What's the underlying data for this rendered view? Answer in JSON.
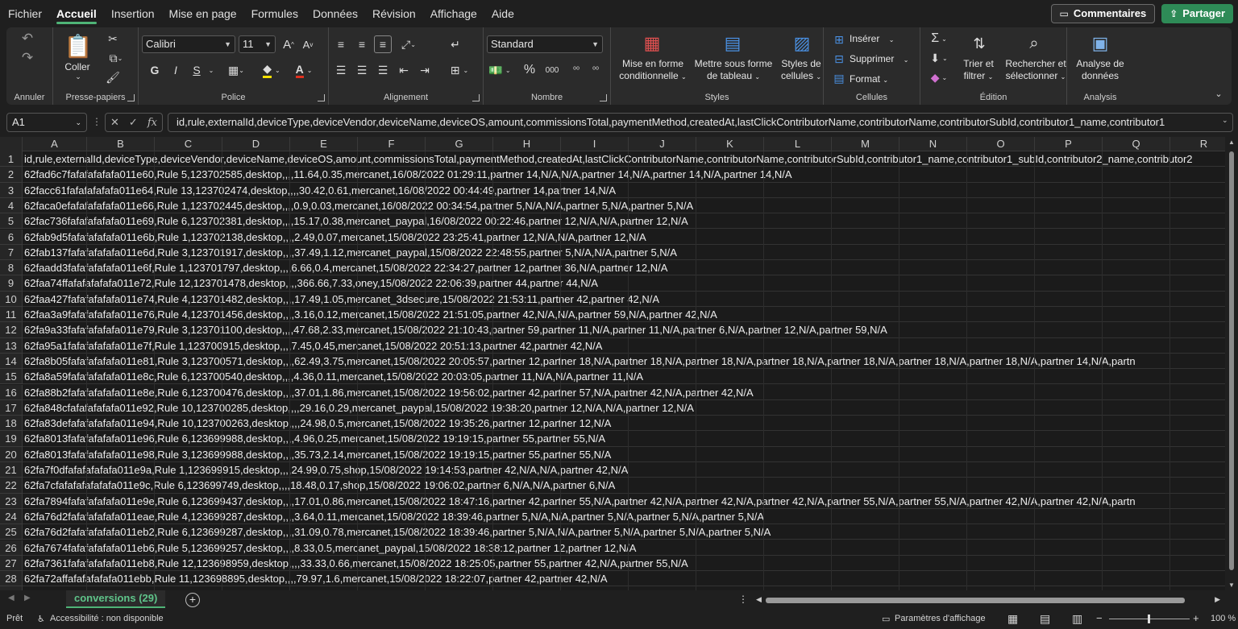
{
  "menu": {
    "items": [
      "Fichier",
      "Accueil",
      "Insertion",
      "Mise en page",
      "Formules",
      "Données",
      "Révision",
      "Affichage",
      "Aide"
    ],
    "active_index": 1,
    "comments_label": "Commentaires",
    "share_label": "Partager"
  },
  "ribbon": {
    "undo_label": "Annuler",
    "clipboard": {
      "paste_label": "Coller",
      "group_label": "Presse-papiers"
    },
    "font": {
      "name": "Calibri",
      "size": "11",
      "group_label": "Police",
      "bold": "G",
      "italic": "I",
      "underline": "S",
      "grow": "A",
      "shrink": "A"
    },
    "alignment": {
      "group_label": "Alignement"
    },
    "number": {
      "format": "Standard",
      "group_label": "Nombre",
      "percent": "%",
      "thousands": "000"
    },
    "styles": {
      "conditional": [
        "Mise en forme",
        "conditionnelle"
      ],
      "table": [
        "Mettre sous forme",
        "de tableau"
      ],
      "cell_styles": [
        "Styles de",
        "cellules"
      ],
      "group_label": "Styles"
    },
    "cells": {
      "insert": "Insérer",
      "delete": "Supprimer",
      "format": "Format",
      "group_label": "Cellules"
    },
    "editing": {
      "sort": [
        "Trier et",
        "filtrer"
      ],
      "find": [
        "Rechercher et",
        "sélectionner"
      ],
      "group_label": "Édition"
    },
    "analysis": {
      "analyze": [
        "Analyse de",
        "données"
      ],
      "group_label": "Analysis"
    }
  },
  "formula_bar": {
    "cell_ref": "A1",
    "content": "id,rule,externalId,deviceType,deviceVendor,deviceName,deviceOS,amount,commissionsTotal,paymentMethod,createdAt,lastClickContributorName,contributorName,contributorSubId,contributor1_name,contributor1"
  },
  "grid": {
    "columns": [
      "A",
      "B",
      "C",
      "D",
      "E",
      "F",
      "G",
      "H",
      "I",
      "J",
      "K",
      "L",
      "M",
      "N",
      "O",
      "P",
      "Q",
      "R"
    ],
    "rows": [
      "id,rule,externalId,deviceType,deviceVendor,deviceName,deviceOS,amount,commissionsTotal,paymentMethod,createdAt,lastClickContributorName,contributorName,contributorSubId,contributor1_name,contributor1_subId,contributor2_name,contributor2",
      "62fad6c7fafafafafafa011e60,Rule 5,123702585,desktop,,,,11.64,0.35,mercanet,16/08/2022 01:29:11,partner 14,N/A,N/A,partner 14,N/A,partner 14,N/A,partner 14,N/A",
      "62facc61fafafafafafa011e64,Rule 13,123702474,desktop,,,,30.42,0.61,mercanet,16/08/2022 00:44:49,partner 14,partner 14,N/A",
      "62faca0efafafafafafa011e66,Rule 1,123702445,desktop,,,,0.9,0.03,mercanet,16/08/2022 00:34:54,partner 5,N/A,N/A,partner 5,N/A,partner 5,N/A",
      "62fac736fafafafafafa011e69,Rule 6,123702381,desktop,,,,15.17,0.38,mercanet_paypal,16/08/2022 00:22:46,partner 12,N/A,N/A,partner 12,N/A",
      "62fab9d5fafafafafafa011e6b,Rule 1,123702138,desktop,,,,2.49,0.07,mercanet,15/08/2022 23:25:41,partner 12,N/A,N/A,partner 12,N/A",
      "62fab137fafafafafafa011e6d,Rule 3,123701917,desktop,,,,37.49,1.12,mercanet_paypal,15/08/2022 22:48:55,partner 5,N/A,N/A,partner 5,N/A",
      "62faadd3fafafafafafa011e6f,Rule 1,123701797,desktop,,,,6.66,0.4,mercanet,15/08/2022 22:34:27,partner 12,partner 36,N/A,partner 12,N/A",
      "62faa74ffafafafafafa011e72,Rule 12,123701478,desktop,,,,366.66,7.33,oney,15/08/2022 22:06:39,partner 44,partner 44,N/A",
      "62faa427fafafafafafa011e74,Rule 4,123701482,desktop,,,,17.49,1.05,mercanet_3dsecure,15/08/2022 21:53:11,partner 42,partner 42,N/A",
      "62faa3a9fafafafafafa011e76,Rule 4,123701456,desktop,,,,3.16,0.12,mercanet,15/08/2022 21:51:05,partner 42,N/A,N/A,partner 59,N/A,partner 42,N/A",
      "62fa9a33fafafafafafa011e79,Rule 3,123701100,desktop,,,,47.68,2.33,mercanet,15/08/2022 21:10:43,partner 59,partner 11,N/A,partner 11,N/A,partner 6,N/A,partner 12,N/A,partner 59,N/A",
      "62fa95a1fafafafafafa011e7f,Rule 1,123700915,desktop,,,,7.45,0.45,mercanet,15/08/2022 20:51:13,partner 42,partner 42,N/A",
      "62fa8b05fafafafafafa011e81,Rule 3,123700571,desktop,,,,62.49,3.75,mercanet,15/08/2022 20:05:57,partner 12,partner 18,N/A,partner 18,N/A,partner 18,N/A,partner 18,N/A,partner 18,N/A,partner 18,N/A,partner 18,N/A,partner 14,N/A,partn",
      "62fa8a59fafafafafafa011e8c,Rule 6,123700540,desktop,,,,4.36,0.11,mercanet,15/08/2022 20:03:05,partner 11,N/A,N/A,partner 11,N/A",
      "62fa88b2fafafafafafa011e8e,Rule 6,123700476,desktop,,,,37.01,1.86,mercanet,15/08/2022 19:56:02,partner 42,partner 57,N/A,partner 42,N/A,partner 42,N/A",
      "62fa848cfafafafafafa011e92,Rule 10,123700285,desktop,,,,29.16,0.29,mercanet_paypal,15/08/2022 19:38:20,partner 12,N/A,N/A,partner 12,N/A",
      "62fa83defafafafafafa011e94,Rule 10,123700263,desktop,,,,24.98,0.5,mercanet,15/08/2022 19:35:26,partner 12,partner 12,N/A",
      "62fa8013fafafafafafa011e96,Rule 6,123699988,desktop,,,,4.96,0.25,mercanet,15/08/2022 19:19:15,partner 55,partner 55,N/A",
      "62fa8013fafafafafafa011e98,Rule 3,123699988,desktop,,,,35.73,2.14,mercanet,15/08/2022 19:19:15,partner 55,partner 55,N/A",
      "62fa7f0dfafafafafafa011e9a,Rule 1,123699915,desktop,,,,24.99,0.75,shop,15/08/2022 19:14:53,partner 42,N/A,N/A,partner 42,N/A",
      "62fa7cfafafafafafafa011e9c,Rule 6,123699749,desktop,,,,18.48,0.17,shop,15/08/2022 19:06:02,partner 6,N/A,N/A,partner 6,N/A",
      "62fa7894fafafafafafa011e9e,Rule 6,123699437,desktop,,,,17.01,0.86,mercanet,15/08/2022 18:47:16,partner 42,partner 55,N/A,partner 42,N/A,partner 42,N/A,partner 42,N/A,partner 55,N/A,partner 55,N/A,partner 42,N/A,partner 42,N/A,partn",
      "62fa76d2fafafafafafa011eae,Rule 4,123699287,desktop,,,,3.64,0.11,mercanet,15/08/2022 18:39:46,partner 5,N/A,N/A,partner 5,N/A,partner 5,N/A,partner 5,N/A",
      "62fa76d2fafafafafafa011eb2,Rule 6,123699287,desktop,,,,31.09,0.78,mercanet,15/08/2022 18:39:46,partner 5,N/A,N/A,partner 5,N/A,partner 5,N/A,partner 5,N/A",
      "62fa7674fafafafafafa011eb6,Rule 5,123699257,desktop,,,,8.33,0.5,mercanet_paypal,15/08/2022 18:38:12,partner 12,partner 12,N/A",
      "62fa7361fafafafafafa011eb8,Rule 12,123698959,desktop,,,,33.33,0.66,mercanet,15/08/2022 18:25:05,partner 55,partner 42,N/A,partner 55,N/A",
      "62fa72affafafafafafa011ebb,Rule 11,123698895,desktop,,,,79.97,1.6,mercanet,15/08/2022 18:22:07,partner 42,partner 42,N/A"
    ]
  },
  "sheet_tabs": {
    "active": "conversions (29)",
    "add_label": "+"
  },
  "status_bar": {
    "ready": "Prêt",
    "accessibility": "Accessibilité : non disponible",
    "display_settings": "Paramètres d'affichage",
    "zoom": "100 %",
    "zoom_minus": "−",
    "zoom_plus": "+"
  }
}
